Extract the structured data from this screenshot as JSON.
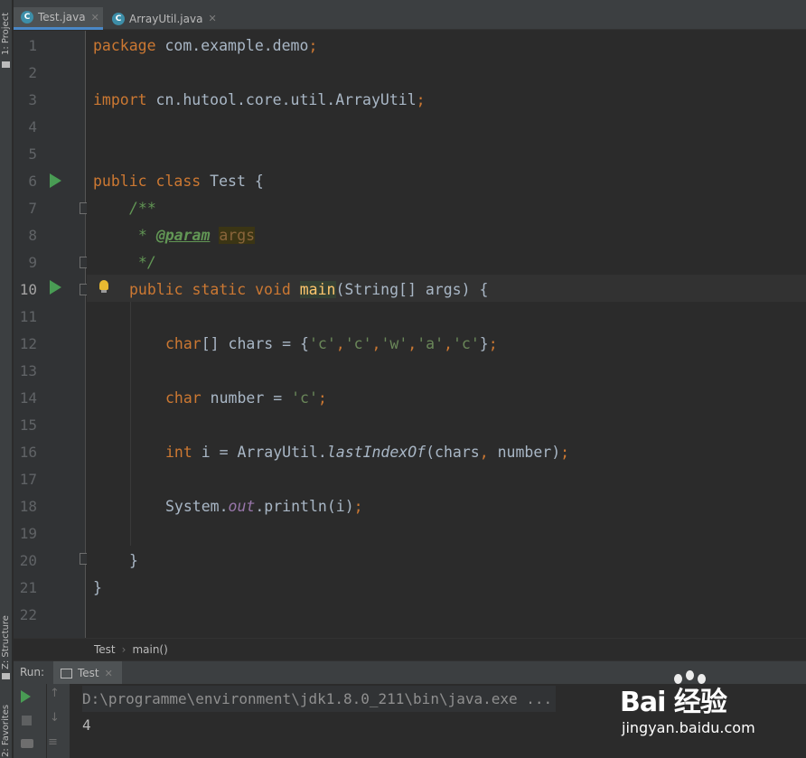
{
  "side_tabs": {
    "project": "1: Project",
    "structure": "Z: Structure",
    "favorites": "2: Favorites"
  },
  "editor_tabs": [
    {
      "label": "Test.java",
      "icon": "class-icon",
      "active": true
    },
    {
      "label": "ArrayUtil.java",
      "icon": "class-icon",
      "active": false
    }
  ],
  "gutter": {
    "current_line": "10",
    "run_markers": [
      6,
      10
    ]
  },
  "code_lines": {
    "l1": {
      "a": "package",
      "b": " com.example.demo",
      "c": ";"
    },
    "l3": {
      "a": "import",
      "b": " cn.hutool.core.util.ArrayUtil",
      "c": ";"
    },
    "l6": {
      "a": "public class",
      "b": " Test {"
    },
    "l7": {
      "a": "/**"
    },
    "l8": {
      "a": " * ",
      "b": "@param",
      "c": " ",
      "d": "args"
    },
    "l9": {
      "a": " */"
    },
    "l10": {
      "a": "public static void",
      "b": " ",
      "c": "main",
      "d": "(String[] args) {"
    },
    "l12": {
      "a": "char",
      "b": "[] chars = {",
      "c": "'c'",
      "d": ",",
      "e": "'c'",
      "f": ",",
      "g": "'w'",
      "h": ",",
      "i": "'a'",
      "j": ",",
      "k": "'c'",
      "l": "}",
      "m": ";"
    },
    "l14": {
      "a": "char",
      "b": " number = ",
      "c": "'c'",
      "d": ";"
    },
    "l16": {
      "a": "int",
      "b": " i = ArrayUtil.",
      "c": "lastIndexOf",
      "d": "(chars",
      "e": ",",
      "f": " number)",
      "g": ";"
    },
    "l18": {
      "a": "System.",
      "b": "out",
      "c": ".println(i)",
      "d": ";"
    },
    "l20": {
      "a": "}"
    },
    "l21": {
      "a": "}"
    }
  },
  "line_numbers": [
    "1",
    "2",
    "3",
    "4",
    "5",
    "6",
    "7",
    "8",
    "9",
    "10",
    "11",
    "12",
    "13",
    "14",
    "15",
    "16",
    "17",
    "18",
    "19",
    "20",
    "21",
    "22"
  ],
  "breadcrumb": {
    "class": "Test",
    "method": "main()"
  },
  "run_panel": {
    "label": "Run:",
    "tab": "Test"
  },
  "console": {
    "command": "D:\\programme\\environment\\jdk1.8.0_211\\bin\\java.exe ...",
    "output": "4"
  },
  "watermark": {
    "brand": "Bai  经验",
    "url": "jingyan.baidu.com"
  },
  "colors": {
    "keyword": "#cc7832",
    "string": "#6a8759",
    "comment": "#629755",
    "method": "#ffc66d",
    "field": "#9876aa",
    "run_green": "#499c54",
    "tab_underline": "#4a88c7"
  }
}
